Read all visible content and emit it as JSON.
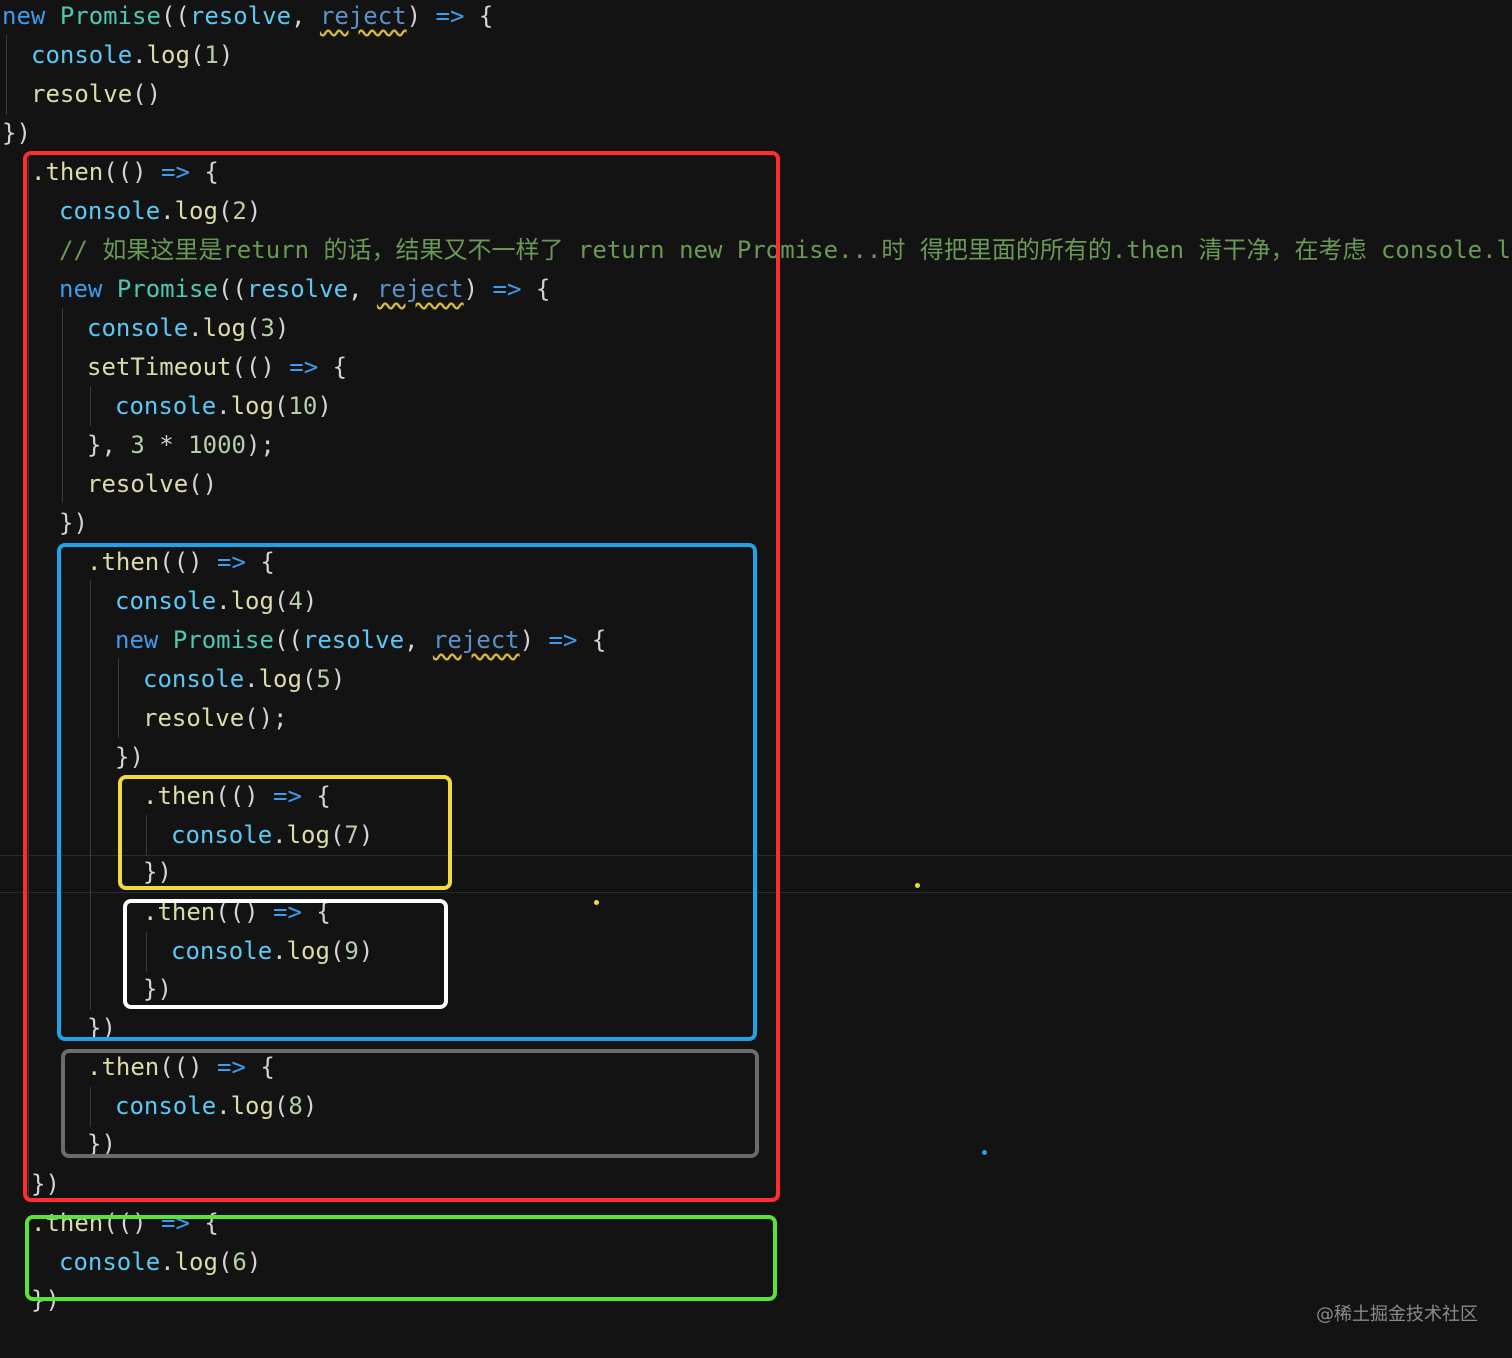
{
  "code": {
    "l1": {
      "kw_new": "new",
      "cls": "Promise",
      "p1": "((",
      "resolve": "resolve",
      "comma": ", ",
      "reject": "reject",
      "p2": ") ",
      "arrow": "=>",
      "brace": " {"
    },
    "l2": {
      "obj": "console",
      "dot": ".",
      "fn": "log",
      "open": "(",
      "num": "1",
      "close": ")"
    },
    "l3": {
      "fn": "resolve",
      "paren": "()"
    },
    "l4": {
      "text": "})"
    },
    "l5": {
      "dot_then": ".then",
      "p": "(() ",
      "arrow": "=>",
      "brace": " {"
    },
    "l6": {
      "obj": "console",
      "dot": ".",
      "fn": "log",
      "open": "(",
      "num": "2",
      "close": ")"
    },
    "l7": {
      "comment": "// 如果这里是return 的话，结果又不一样了 return new Promise...时 得把里面的所有的.then 清干净，在考虑 console.log("
    },
    "l8": {
      "kw_new": "new",
      "cls": "Promise",
      "p1": "((",
      "resolve": "resolve",
      "comma": ", ",
      "reject": "reject",
      "p2": ") ",
      "arrow": "=>",
      "brace": " {"
    },
    "l9": {
      "obj": "console",
      "dot": ".",
      "fn": "log",
      "open": "(",
      "num": "3",
      "close": ")"
    },
    "l10": {
      "fn": "setTimeout",
      "p": "(() ",
      "arrow": "=>",
      "brace": " {"
    },
    "l11": {
      "obj": "console",
      "dot": ".",
      "fn": "log",
      "open": "(",
      "num": "10",
      "close": ")"
    },
    "l12": {
      "pre": "}, ",
      "num1": "3",
      "op": " * ",
      "num2": "1000",
      "post": ");"
    },
    "l13": {
      "fn": "resolve",
      "paren": "()"
    },
    "l14": {
      "text": "})"
    },
    "l15": {
      "dot_then": ".then",
      "p": "(() ",
      "arrow": "=>",
      "brace": " {"
    },
    "l16": {
      "obj": "console",
      "dot": ".",
      "fn": "log",
      "open": "(",
      "num": "4",
      "close": ")"
    },
    "l17": {
      "kw_new": "new",
      "cls": "Promise",
      "p1": "((",
      "resolve": "resolve",
      "comma": ", ",
      "reject": "reject",
      "p2": ") ",
      "arrow": "=>",
      "brace": " {"
    },
    "l18": {
      "obj": "console",
      "dot": ".",
      "fn": "log",
      "open": "(",
      "num": "5",
      "close": ")"
    },
    "l19": {
      "fn": "resolve",
      "paren": "();"
    },
    "l20": {
      "text": "})"
    },
    "l21": {
      "dot_then": ".then",
      "p": "(() ",
      "arrow": "=>",
      "brace": " {"
    },
    "l22": {
      "obj": "console",
      "dot": ".",
      "fn": "log",
      "open": "(",
      "num": "7",
      "close": ")"
    },
    "l23": {
      "text": "})"
    },
    "l24": {
      "dot_then": ".then",
      "p": "(() ",
      "arrow": "=>",
      "brace": " {"
    },
    "l25": {
      "obj": "console",
      "dot": ".",
      "fn": "log",
      "open": "(",
      "num": "9",
      "close": ")"
    },
    "l26": {
      "text": "})"
    },
    "l27": {
      "text": "})"
    },
    "l28": {
      "dot_then": ".then",
      "p": "(() ",
      "arrow": "=>",
      "brace": " {"
    },
    "l29": {
      "obj": "console",
      "dot": ".",
      "fn": "log",
      "open": "(",
      "num": "8",
      "close": ")"
    },
    "l30": {
      "text": "})"
    },
    "l31": {
      "text": "})"
    },
    "l32": {
      "dot_then": ".then",
      "p": "(() ",
      "arrow": "=>",
      "brace": " {"
    },
    "l33": {
      "obj": "console",
      "dot": ".",
      "fn": "log",
      "open": "(",
      "num": "6",
      "close": ")"
    },
    "l34": {
      "text": "})"
    }
  },
  "annotations": {
    "colors": {
      "red": "#ff2d2d",
      "blue": "#1fa3ea",
      "yellow": "#f2da3a",
      "white": "#ffffff",
      "gray": "#6b6b6b",
      "green": "#5be33a"
    }
  },
  "watermark": "@稀土掘金技术社区"
}
